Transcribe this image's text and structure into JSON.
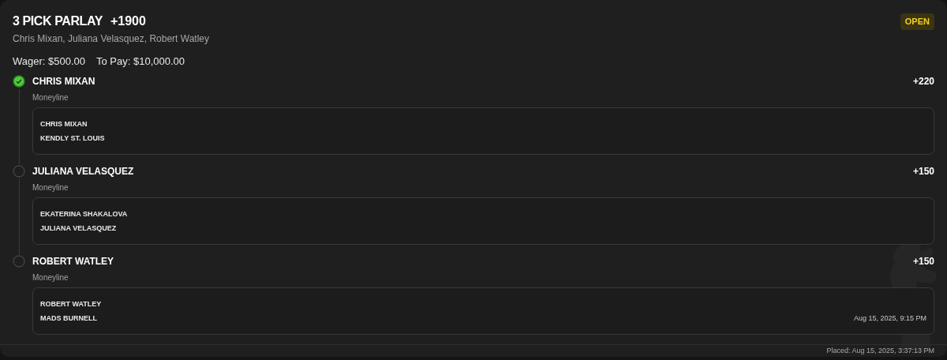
{
  "bet": {
    "title": "3 PICK PARLAY",
    "odds": "+1900",
    "status": "OPEN",
    "picks_summary": "Chris Mixan, Juliana Velasquez, Robert Watley",
    "wager": "Wager: $500.00",
    "to_pay": "To Pay: $10,000.00"
  },
  "legs": [
    {
      "selection": "CHRIS MIXAN",
      "checked": true,
      "market": "Moneyline",
      "odds": "+220",
      "competitors": [
        "CHRIS MIXAN",
        "KENDLY ST. LOUIS"
      ]
    },
    {
      "selection": "JULIANA VELASQUEZ",
      "checked": false,
      "market": "Moneyline",
      "odds": "+150",
      "competitors": [
        "EKATERINA SHAKALOVA",
        "JULIANA VELASQUEZ"
      ]
    },
    {
      "selection": "ROBERT WATLEY",
      "checked": false,
      "market": "Moneyline",
      "odds": "+150",
      "competitors": [
        "ROBERT WATLEY",
        "MADS BURNELL"
      ],
      "event_time": "Aug 15, 2025, 9:15 PM"
    }
  ],
  "footer": {
    "placed": "Placed: Aug 15, 2025, 3:37:13 PM"
  }
}
